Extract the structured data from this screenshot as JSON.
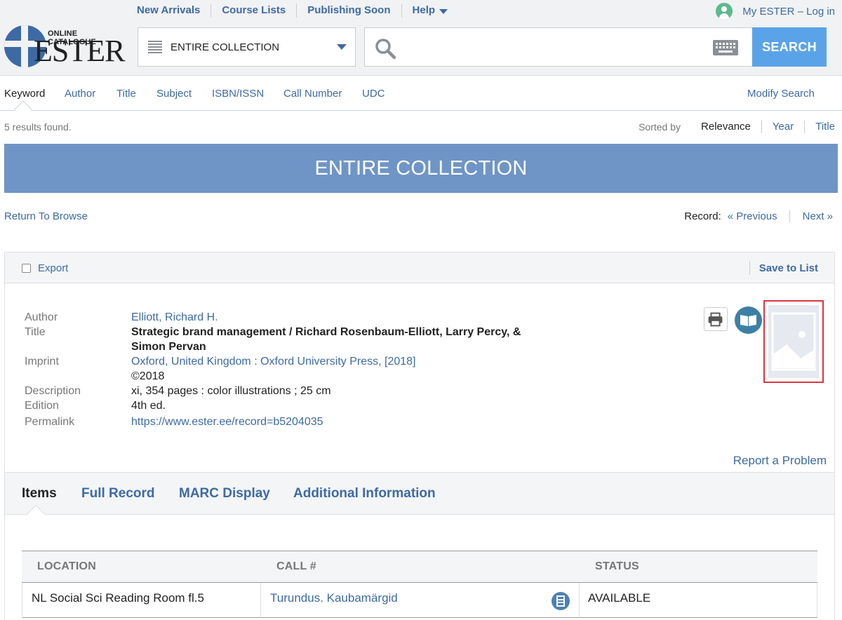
{
  "topnav": {
    "items": [
      "New Arrivals",
      "Course Lists",
      "Publishing Soon",
      "Help"
    ],
    "login": "My ESTER – Log in"
  },
  "logo": {
    "small": "ONLINE CATALOGUE",
    "big": "ESTER"
  },
  "search": {
    "scope": "ENTIRE COLLECTION",
    "query": "",
    "button": "SEARCH",
    "accent": "#5ba3e8"
  },
  "search_types": {
    "items": [
      "Keyword",
      "Author",
      "Title",
      "Subject",
      "ISBN/ISSN",
      "Call Number",
      "UDC"
    ],
    "active": "Keyword",
    "modify": "Modify Search"
  },
  "results": {
    "count_text": "5 results found.",
    "sorted_label": "Sorted by",
    "sort_options": [
      "Relevance",
      "Year",
      "Title"
    ],
    "sort_current": "Relevance"
  },
  "banner": {
    "title": "ENTIRE COLLECTION",
    "color": "#6f95c6"
  },
  "record_nav": {
    "return": "Return To Browse",
    "label": "Record:",
    "previous": "« Previous",
    "next": "Next »"
  },
  "toolbar": {
    "export": "Export",
    "save": "Save to List"
  },
  "record": {
    "author_label": "Author",
    "author": "Elliott, Richard H.",
    "title_label": "Title",
    "title": "Strategic brand management / Richard Rosenbaum-Elliott, Larry Percy, &",
    "title_cont": "Simon Pervan",
    "imprint_label": "Imprint",
    "imprint": "Oxford, United Kingdom : Oxford University Press, [2018]",
    "imprint_year": "©2018",
    "description_label": "Description",
    "description": "xi, 354 pages : color illustrations ; 25 cm",
    "edition_label": "Edition",
    "edition": "4th ed.",
    "permalink_label": "Permalink",
    "permalink": "https://www.ester.ee/record=b5204035"
  },
  "report": "Report a Problem",
  "detail_tabs": {
    "items": [
      "Items",
      "Full Record",
      "MARC Display",
      "Additional Information"
    ],
    "active": "Items"
  },
  "items_table": {
    "headers": [
      "LOCATION",
      "CALL #",
      "STATUS"
    ],
    "rows": [
      {
        "location": "NL Social Sci Reading Room fl.5",
        "call": "Turundus. Kaubamärgid",
        "status": "AVAILABLE"
      }
    ]
  }
}
